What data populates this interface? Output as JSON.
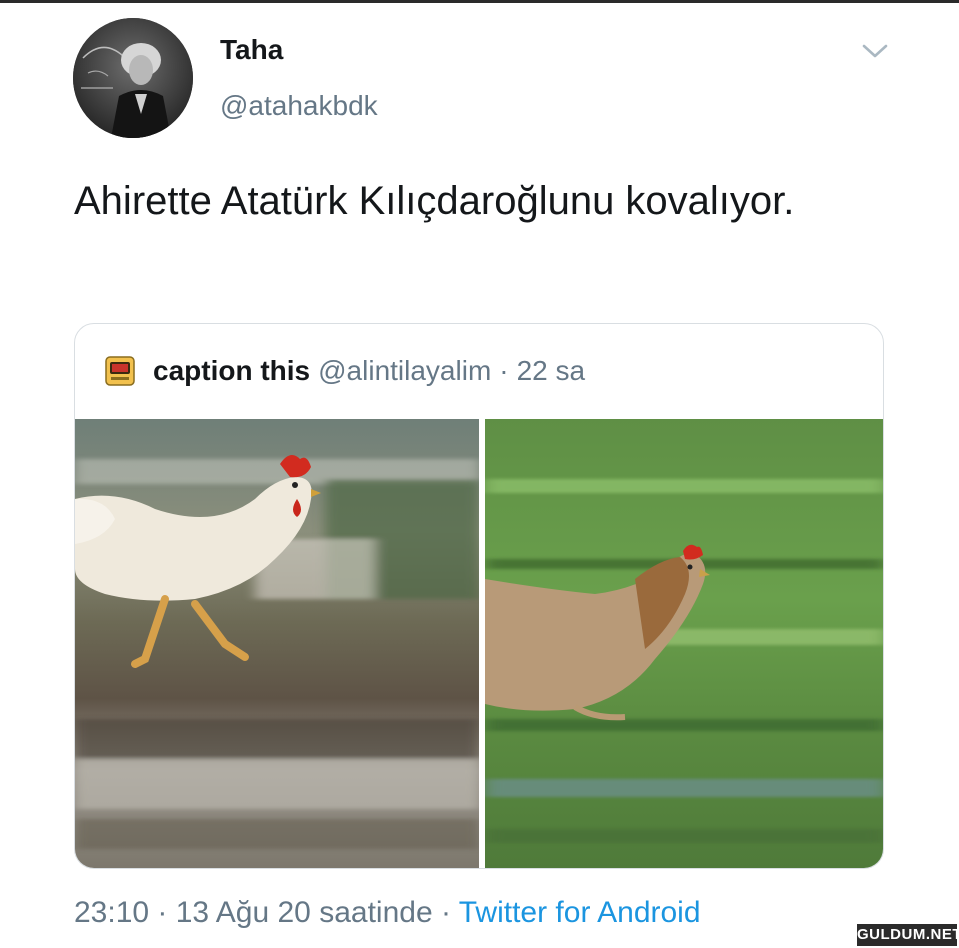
{
  "tweet": {
    "display_name": "Taha",
    "handle": "@atahakbdk",
    "text": "Ahirette Atatürk Kılıçdaroğlunu kovalıyor.",
    "timestamp": "23:10 · 13 Ağu 20 saatinde",
    "separator": " · ",
    "source": "Twitter for Android",
    "menu_icon": "chevron-down-icon",
    "avatar_icon": "profile-avatar"
  },
  "quoted_tweet": {
    "display_name": "caption this",
    "handle": "@alintilayalim",
    "separator": "·",
    "time": "22 sa",
    "avatar_icon": "quote-avatar-icon",
    "images": [
      {
        "subject": "white chicken running"
      },
      {
        "subject": "brown chicken running"
      }
    ]
  },
  "watermark": {
    "text": "GULDUM.NET"
  },
  "colors": {
    "text_primary": "#14171a",
    "text_secondary": "#657786",
    "link": "#1b95e0",
    "border": "#d9dee2"
  }
}
